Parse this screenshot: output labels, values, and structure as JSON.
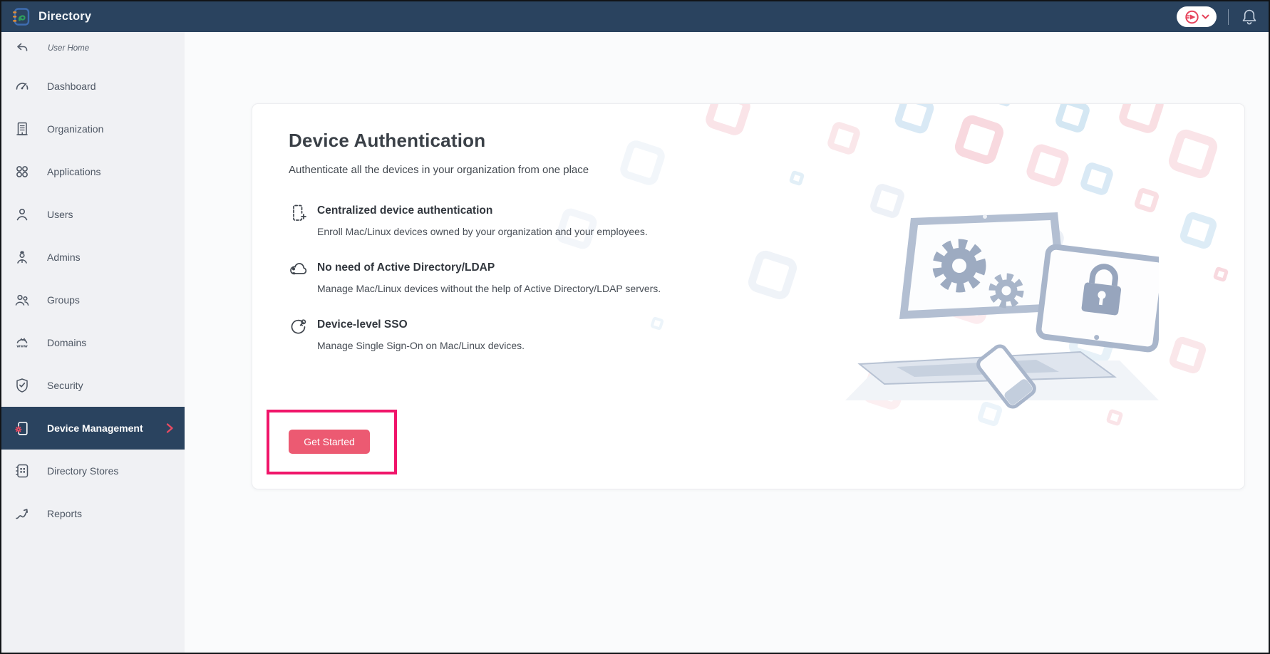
{
  "topbar": {
    "title": "Directory",
    "icons": [
      "directory-logo",
      "account-avatar",
      "chevron-down-icon",
      "bell-icon"
    ]
  },
  "sidebar": {
    "back_item": {
      "label": "User Home",
      "icon": "back-arrow-icon"
    },
    "items": [
      {
        "label": "Dashboard",
        "icon": "dashboard-icon",
        "selected": false
      },
      {
        "label": "Organization",
        "icon": "organization-icon",
        "selected": false
      },
      {
        "label": "Applications",
        "icon": "applications-icon",
        "selected": false
      },
      {
        "label": "Users",
        "icon": "users-icon",
        "selected": false
      },
      {
        "label": "Admins",
        "icon": "admins-icon",
        "selected": false
      },
      {
        "label": "Groups",
        "icon": "groups-icon",
        "selected": false
      },
      {
        "label": "Domains",
        "icon": "domains-icon",
        "selected": false
      },
      {
        "label": "Security",
        "icon": "security-icon",
        "selected": false
      },
      {
        "label": "Device Management",
        "icon": "device-management-icon",
        "selected": true
      },
      {
        "label": "Directory Stores",
        "icon": "directory-stores-icon",
        "selected": false
      },
      {
        "label": "Reports",
        "icon": "reports-icon",
        "selected": false
      }
    ]
  },
  "main": {
    "heading": "Device Authentication",
    "subtitle": "Authenticate all the devices in your organization from one place",
    "features": [
      {
        "icon": "device-add-icon",
        "title": "Centralized device authentication",
        "description": "Enroll Mac/Linux devices owned by your organization and your employees."
      },
      {
        "icon": "cloud-user-icon",
        "title": "No need of Active Directory/LDAP",
        "description": "Manage Mac/Linux devices without the help of Active Directory/LDAP servers."
      },
      {
        "icon": "sso-key-icon",
        "title": "Device-level SSO",
        "description": "Manage Single Sign-On on Mac/Linux devices."
      }
    ],
    "cta_label": "Get Started"
  },
  "colors": {
    "topbar_navy": "#2a435f",
    "sidebar_bg": "#f0f1f4",
    "selected_item_bg": "#2a435f",
    "accent_red": "#e84b62",
    "button_pink": "#ec5a72",
    "annotation_pink": "#f0156a",
    "content_bg": "#fafbfc"
  }
}
